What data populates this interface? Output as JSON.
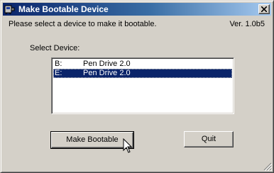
{
  "window": {
    "title": "Make Bootable Device",
    "icon": "usb-drive-icon",
    "close_icon": "close-icon"
  },
  "header": {
    "prompt": "Please select a device to make it bootable.",
    "version": "Ver. 1.0b5"
  },
  "device_select": {
    "label": "Select Device:",
    "items": [
      {
        "letter": "B:",
        "name": "Pen Drive 2.0",
        "selected": false
      },
      {
        "letter": "E:",
        "name": "Pen Drive 2.0",
        "selected": true
      }
    ]
  },
  "buttons": {
    "make_bootable": "Make Bootable",
    "quit": "Quit"
  },
  "colors": {
    "face": "#d4d0c8",
    "title_start": "#0a246a",
    "title_end": "#a6caf0",
    "selection": "#0a246a"
  }
}
